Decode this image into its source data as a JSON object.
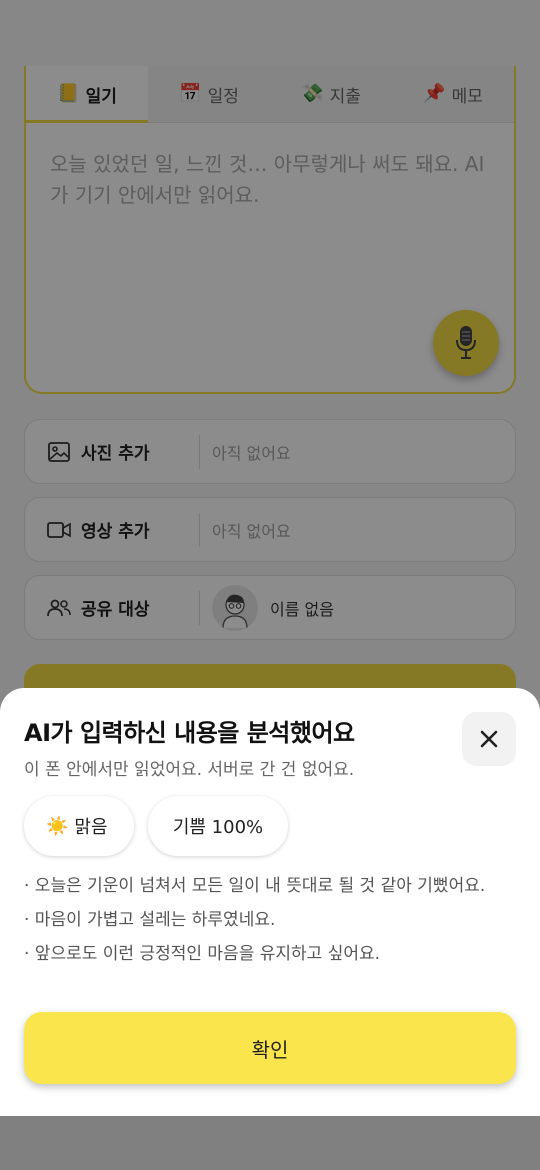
{
  "tabs": [
    {
      "label": "일기",
      "icon": "📒",
      "icon_name": "notebook-icon",
      "active": true
    },
    {
      "label": "일정",
      "icon": "📅",
      "icon_name": "calendar-icon",
      "active": false
    },
    {
      "label": "지출",
      "icon": "💸",
      "icon_name": "money-icon",
      "active": false
    },
    {
      "label": "메모",
      "icon": "📌",
      "icon_name": "pin-icon",
      "active": false
    }
  ],
  "editor": {
    "placeholder": "오늘 있었던 일, 느낀 것… 아무렇게나 써도 돼요. AI 가 기기 안에서만 읽어요."
  },
  "rows": {
    "photo": {
      "label": "사진 추가",
      "value": "아직 없어요"
    },
    "video": {
      "label": "영상 추가",
      "value": "아직 없어요"
    },
    "share": {
      "label": "공유 대상",
      "value": "이름 없음"
    }
  },
  "sheet": {
    "title": "AI가 입력하신 내용을 분석했어요",
    "subtitle": "이 폰 안에서만 읽었어요. 서버로 간 건 없어요.",
    "weather_chip": {
      "icon": "☀️",
      "label": "맑음"
    },
    "mood_chip": {
      "label": "기쁨 100%"
    },
    "notes": [
      "· 오늘은 기운이 넘쳐서 모든 일이 내 뜻대로 될 것 같아 기뻤어요.",
      "· 마음이 가볍고 설레는 하루였네요.",
      "· 앞으로도 이런 긍정적인 마음을 유지하고 싶어요."
    ],
    "confirm_label": "확인"
  },
  "colors": {
    "accent": "#F3DC45",
    "confirm": "#FBE54C",
    "overlay": "rgba(0,0,0,0.45)"
  }
}
